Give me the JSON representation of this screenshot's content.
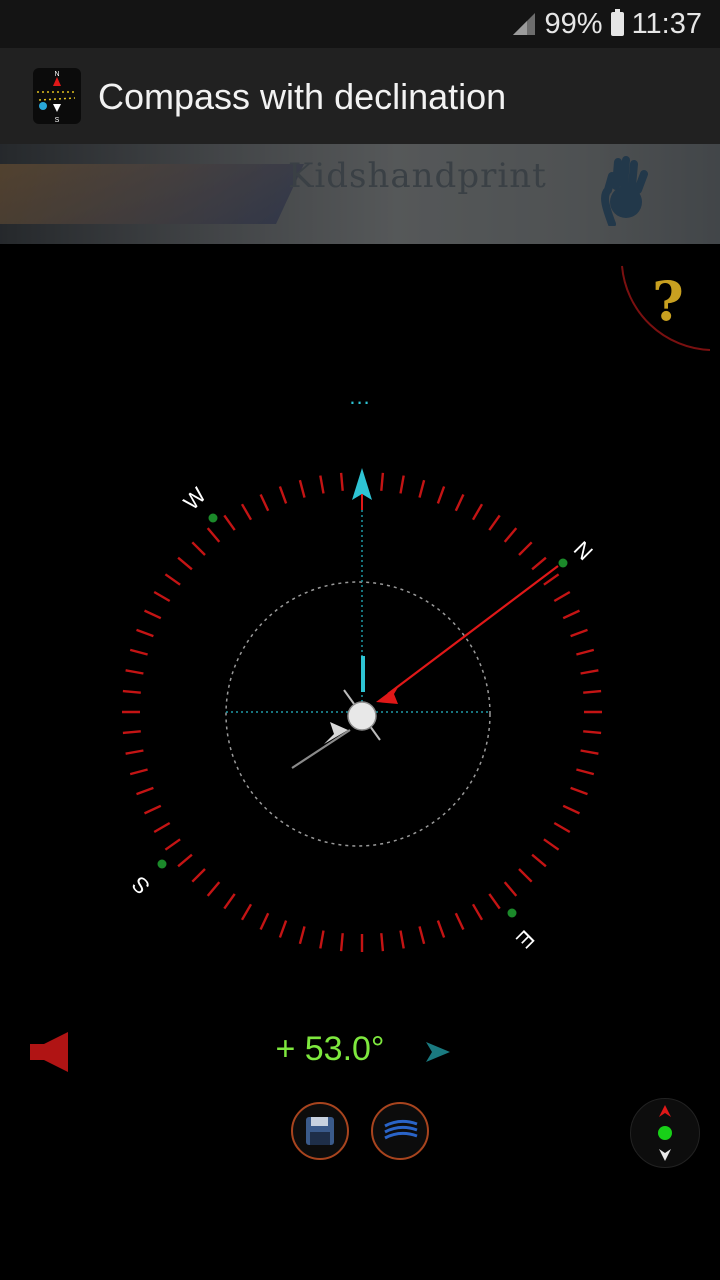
{
  "status_bar": {
    "battery": "99%",
    "time": "11:37"
  },
  "app_bar": {
    "title": "Compass with declination"
  },
  "ad": {
    "text": "Kidshandprint"
  },
  "compass": {
    "more_label": "...",
    "cardinals": {
      "n": "N",
      "e": "E",
      "s": "S",
      "w": "W"
    },
    "declination_display": "+ 53.0°"
  },
  "colors": {
    "accent_cyan": "#2ec4d4",
    "needle_red": "#e01818",
    "tick_red": "#c41414",
    "declination_green": "#7ee83e",
    "help_gold": "#c8a020"
  },
  "icons": {
    "help": "question-mark-icon",
    "speaker": "speaker-icon",
    "save": "floppy-disk-icon",
    "calibrate": "calibration-icon",
    "mini_compass": "compass-icon"
  }
}
